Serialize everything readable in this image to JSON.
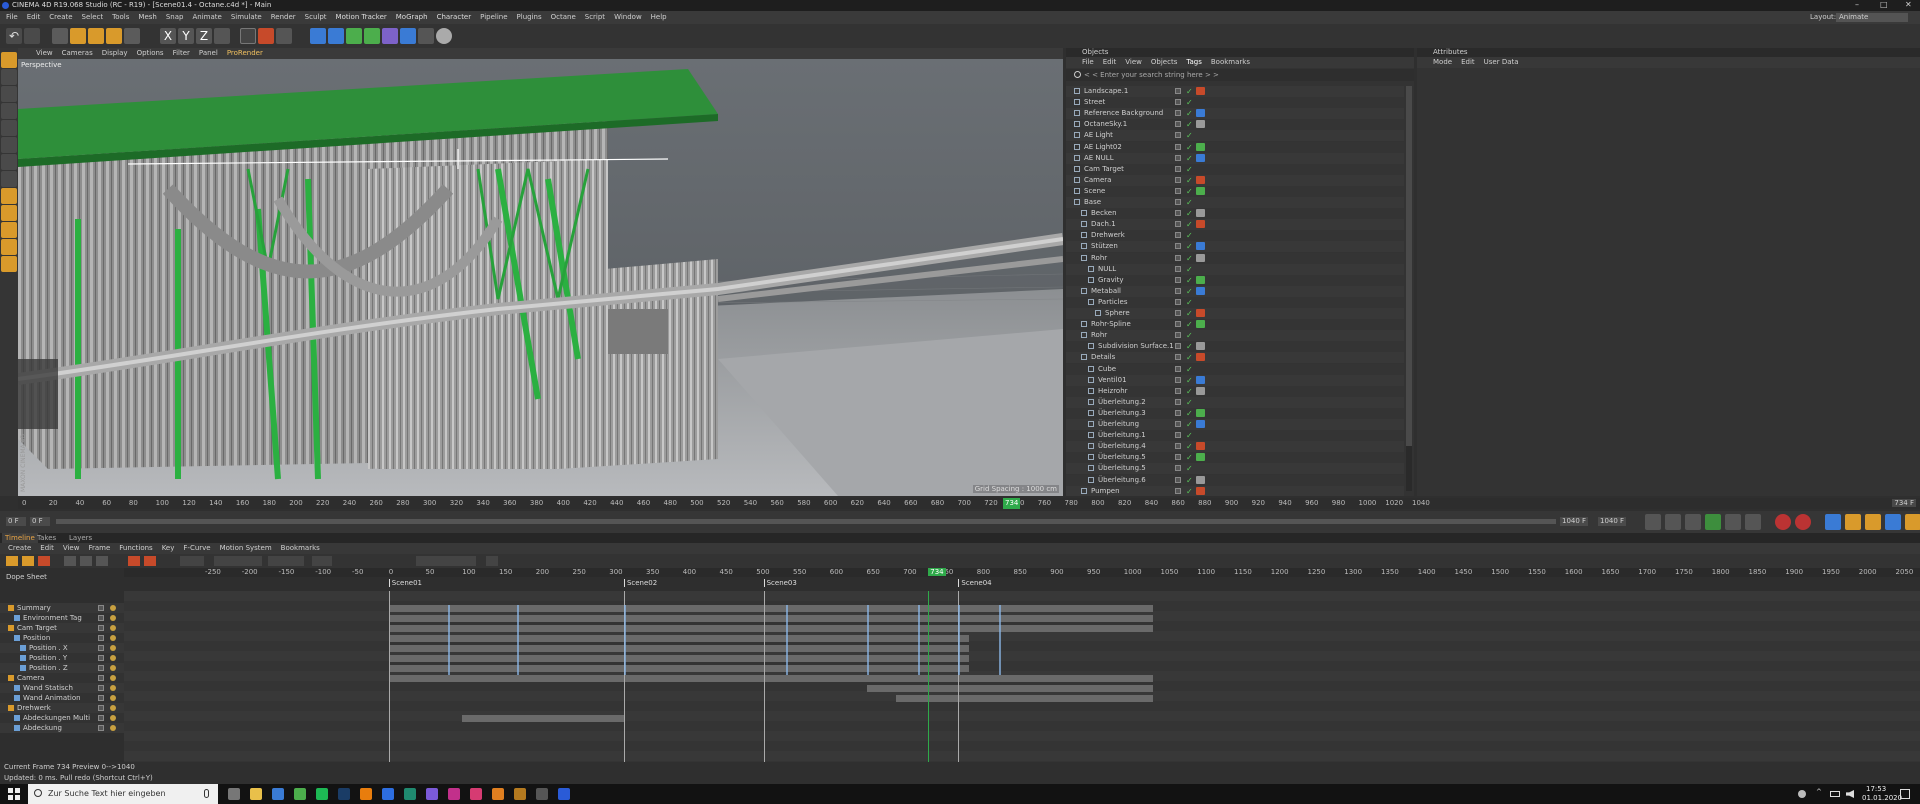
{
  "titlebar": {
    "title": "CINEMA 4D R19.068 Studio (RC - R19) - [Scene01.4 - Octane.c4d *] - Main",
    "minimize": "–",
    "maximize": "□",
    "close": "✕"
  },
  "menubar": {
    "items": [
      "File",
      "Edit",
      "Create",
      "Select",
      "Tools",
      "Mesh",
      "Snap",
      "Animate",
      "Simulate",
      "Render",
      "Sculpt",
      "Motion Tracker",
      "MoGraph",
      "Character",
      "Pipeline",
      "Plugins",
      "Octane",
      "Script",
      "Window",
      "Help"
    ],
    "layout_label": "Layout:",
    "layout_value": "Animate"
  },
  "toolbar": {
    "axis": [
      "X",
      "Y",
      "Z"
    ]
  },
  "viewport": {
    "menu": [
      "View",
      "Cameras",
      "Display",
      "Options",
      "Filter",
      "Panel",
      "ProRender"
    ],
    "label": "Perspective",
    "grid_spacing": "Grid Spacing : 1000 cm",
    "logo": "MAXON CINEMA 4D"
  },
  "objects_panel": {
    "title": "Objects",
    "menu": [
      "File",
      "Edit",
      "View",
      "Objects",
      "Tags",
      "Bookmarks"
    ],
    "search_placeholder": "< < Enter your search string here > >",
    "rows": [
      {
        "name": "Landscape.1",
        "indent": 0
      },
      {
        "name": "Street",
        "indent": 0
      },
      {
        "name": "Reference Background",
        "indent": 0
      },
      {
        "name": "OctaneSky.1",
        "indent": 0
      },
      {
        "name": "AE Light",
        "indent": 0
      },
      {
        "name": "AE Light02",
        "indent": 0
      },
      {
        "name": "AE NULL",
        "indent": 0
      },
      {
        "name": "Cam Target",
        "indent": 0
      },
      {
        "name": "Camera",
        "indent": 0
      },
      {
        "name": "Scene",
        "indent": 0
      },
      {
        "name": "Base",
        "indent": 0
      },
      {
        "name": "Becken",
        "indent": 1
      },
      {
        "name": "Dach.1",
        "indent": 1
      },
      {
        "name": "Drehwerk",
        "indent": 1
      },
      {
        "name": "Stützen",
        "indent": 1
      },
      {
        "name": "Rohr",
        "indent": 1
      },
      {
        "name": "NULL",
        "indent": 2
      },
      {
        "name": "Gravity",
        "indent": 2
      },
      {
        "name": "Metaball",
        "indent": 1
      },
      {
        "name": "Particles",
        "indent": 2
      },
      {
        "name": "Sphere",
        "indent": 3
      },
      {
        "name": "Rohr-Spline",
        "indent": 1
      },
      {
        "name": "Rohr",
        "indent": 1
      },
      {
        "name": "Subdivision Surface.1",
        "indent": 2
      },
      {
        "name": "Details",
        "indent": 1
      },
      {
        "name": "Cube",
        "indent": 2
      },
      {
        "name": "Ventil01",
        "indent": 2
      },
      {
        "name": "Heizrohr",
        "indent": 2
      },
      {
        "name": "Überleitung.2",
        "indent": 2
      },
      {
        "name": "Überleitung.3",
        "indent": 2
      },
      {
        "name": "Überleitung",
        "indent": 2
      },
      {
        "name": "Überleitung.1",
        "indent": 2
      },
      {
        "name": "Überleitung.4",
        "indent": 2
      },
      {
        "name": "Überleitung.5",
        "indent": 2
      },
      {
        "name": "Überleitung.5",
        "indent": 2
      },
      {
        "name": "Überleitung.6",
        "indent": 2
      },
      {
        "name": "Pumpen",
        "indent": 1
      }
    ]
  },
  "attributes_panel": {
    "title": "Attributes",
    "menu": [
      "Mode",
      "Edit",
      "User Data"
    ]
  },
  "main_ruler": {
    "labels": [
      "0",
      "20",
      "40",
      "60",
      "80",
      "100",
      "120",
      "140",
      "160",
      "180",
      "200",
      "220",
      "240",
      "260",
      "280",
      "300",
      "320",
      "340",
      "360",
      "380",
      "400",
      "420",
      "440",
      "460",
      "480",
      "500",
      "520",
      "540",
      "560",
      "580",
      "600",
      "620",
      "640",
      "660",
      "680",
      "700",
      "720",
      "740",
      "760",
      "780",
      "800",
      "820",
      "840",
      "860",
      "880",
      "900",
      "920",
      "940",
      "960",
      "980",
      "1000",
      "1020",
      "1040"
    ],
    "current": "734",
    "end_label": "734 F",
    "max": 1040,
    "current_value": 734
  },
  "transport": {
    "start_field": "0 F",
    "mid_field": "0 F",
    "end_field": "1040 F",
    "end_field2": "1040 F"
  },
  "timeline": {
    "tabs": [
      "Timeline",
      "Takes",
      "Layers"
    ],
    "menu": [
      "Create",
      "Edit",
      "View",
      "Frame",
      "Functions",
      "Key",
      "F-Curve",
      "Motion System",
      "Bookmarks"
    ],
    "header": "Dope Sheet",
    "ruler_labels": [
      "-250",
      "-200",
      "-150",
      "-100",
      "-50",
      "0",
      "50",
      "100",
      "150",
      "200",
      "250",
      "300",
      "350",
      "400",
      "450",
      "500",
      "550",
      "600",
      "650",
      "700",
      "750",
      "800",
      "850",
      "900",
      "950",
      "1000",
      "1050",
      "1100",
      "1150",
      "1200",
      "1250",
      "1300",
      "1350",
      "1400",
      "1450",
      "1500",
      "1550",
      "1600",
      "1650",
      "1700",
      "1750",
      "1800",
      "1850",
      "1900",
      "1950",
      "2000",
      "2050",
      "2100",
      "2150"
    ],
    "current": "734",
    "current_value": 734,
    "markers": [
      {
        "label": "Scene01",
        "frame": 0
      },
      {
        "label": "Scene02",
        "frame": 320
      },
      {
        "label": "Scene03",
        "frame": 510
      },
      {
        "label": "Scene04",
        "frame": 775
      }
    ],
    "tracks": [
      {
        "name": "Summary",
        "indent": 0
      },
      {
        "name": "Environment Tag",
        "indent": 1
      },
      {
        "name": "Cam Target",
        "indent": 0
      },
      {
        "name": "Position",
        "indent": 1
      },
      {
        "name": "Position . X",
        "indent": 2
      },
      {
        "name": "Position . Y",
        "indent": 2
      },
      {
        "name": "Position . Z",
        "indent": 2
      },
      {
        "name": "Camera",
        "indent": 0
      },
      {
        "name": "Wand Statisch",
        "indent": 1
      },
      {
        "name": "Wand Animation",
        "indent": 1
      },
      {
        "name": "Drehwerk",
        "indent": 0
      },
      {
        "name": "Abdeckungen Multi",
        "indent": 1
      },
      {
        "name": "Abdeckung",
        "indent": 1
      }
    ]
  },
  "statusbar": {
    "frame_info": "Current Frame  734  Preview  0-->1040",
    "message": "Updated: 0 ms.    Pull redo (Shortcut Ctrl+Y)"
  },
  "taskbar": {
    "search_placeholder": "Zur Suche Text hier eingeben",
    "time": "17:53",
    "date": "01.01.2020"
  }
}
